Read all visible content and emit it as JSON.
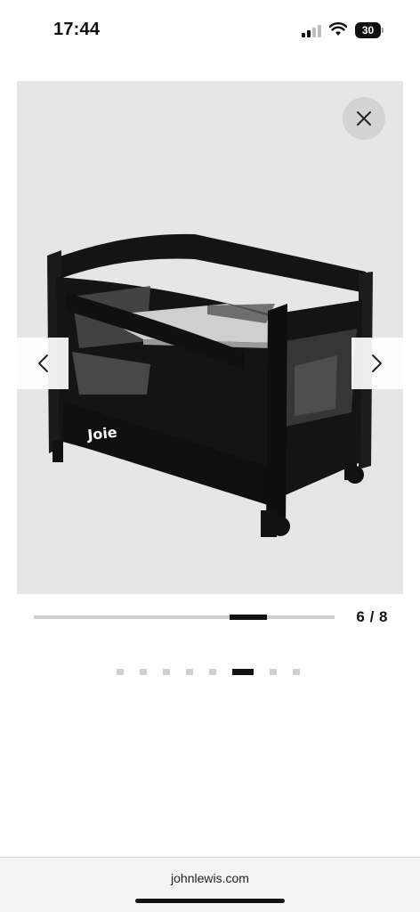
{
  "status_bar": {
    "time": "17:44",
    "battery_level": "30",
    "icons": [
      "signal-icon",
      "wifi-icon",
      "battery-icon"
    ]
  },
  "gallery": {
    "image_alt": "Joie cot",
    "brand_text": "Joie",
    "counter": "6 / 8",
    "current_index": 6,
    "total": 8,
    "progress_fraction": 0.75,
    "icons": {
      "close": "close-icon",
      "prev": "chevron-left-icon",
      "next": "chevron-right-icon"
    }
  },
  "browser": {
    "url": "johnlewis.com"
  },
  "colors": {
    "accent": "#111111",
    "inactive": "#cfcfcf",
    "gallery_bg": "#e6e6e6"
  }
}
